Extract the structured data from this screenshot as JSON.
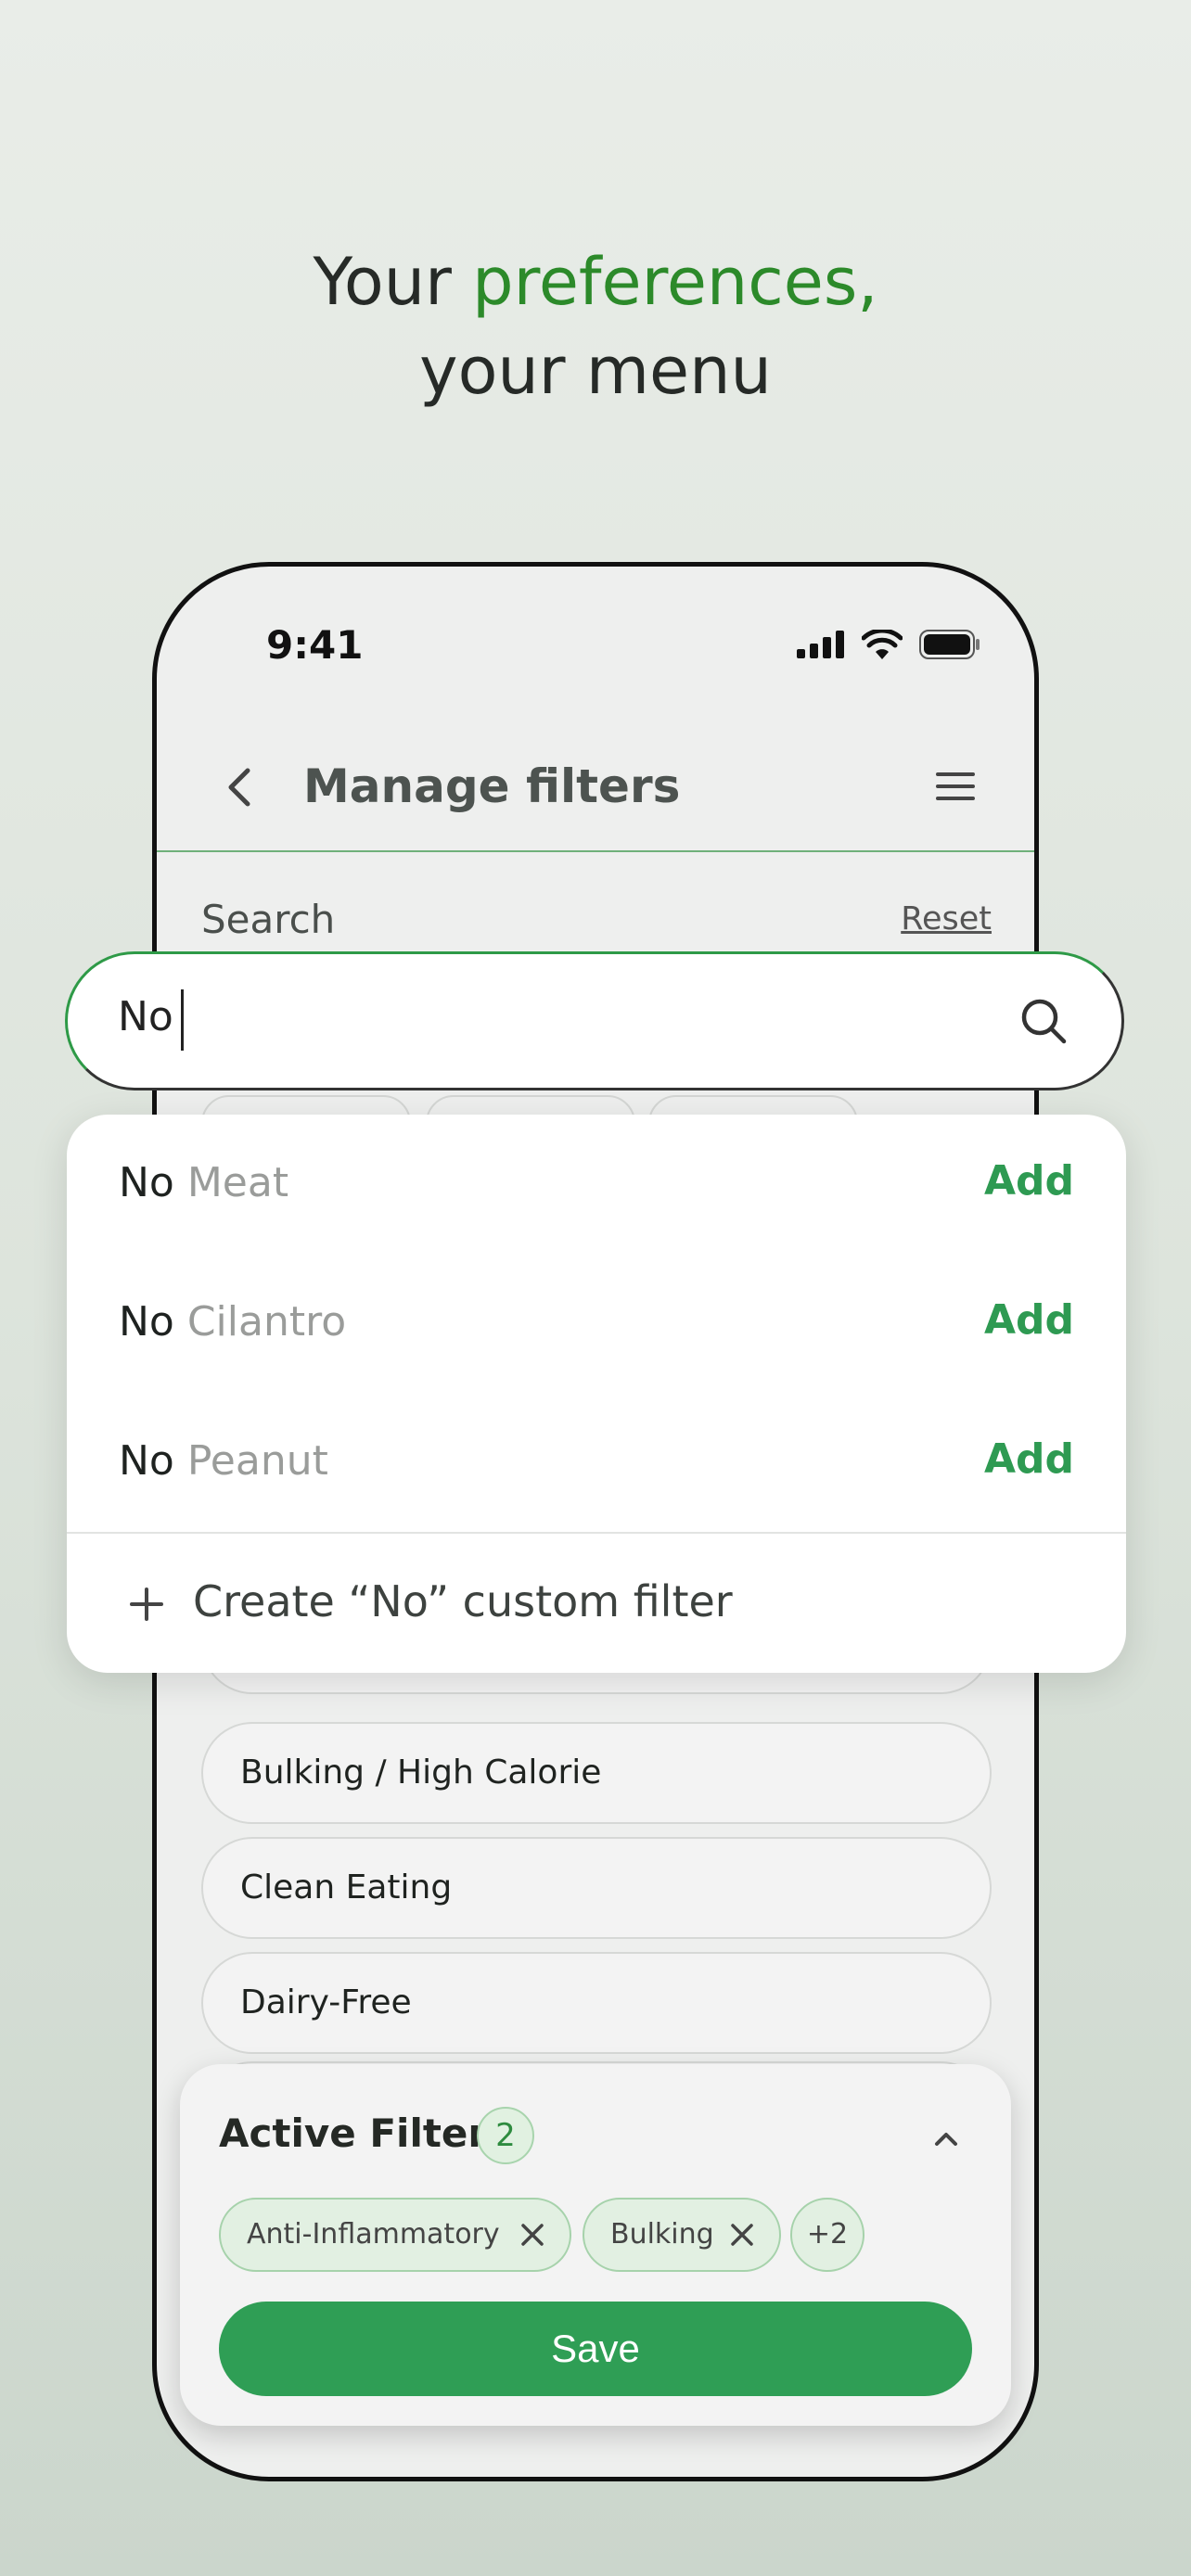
{
  "headline": {
    "line1_plain": "Your ",
    "line1_accent": "preferences,",
    "line2": "your menu"
  },
  "status_bar": {
    "time": "9:41"
  },
  "app_bar": {
    "title": "Manage filters"
  },
  "search": {
    "label": "Search",
    "reset_label": "Reset",
    "value": "No",
    "prefix": "No"
  },
  "suggestions": [
    {
      "rest": " Meat",
      "action": "Add"
    },
    {
      "rest": " Cilantro",
      "action": "Add"
    },
    {
      "rest": " Peanut",
      "action": "Add"
    }
  ],
  "create_custom": {
    "label": "Create “No” custom filter"
  },
  "filter_list": [
    "Bulking / High Calorie",
    "Clean Eating",
    "Dairy-Free"
  ],
  "active_filters": {
    "heading": "Active Filters",
    "count": "2",
    "chips": [
      "Anti-Inflammatory",
      "Bulking"
    ],
    "more": "+2",
    "save_label": "Save"
  },
  "colors": {
    "accent_green": "#2e9a52",
    "headline_green": "#2c8a2a",
    "save_bg": "#2f9e55"
  },
  "icons": [
    "back-arrow-icon",
    "hamburger-menu-icon",
    "search-icon",
    "plus-icon",
    "chevron-up-icon",
    "close-icon",
    "signal-icon",
    "wifi-icon",
    "battery-icon"
  ]
}
